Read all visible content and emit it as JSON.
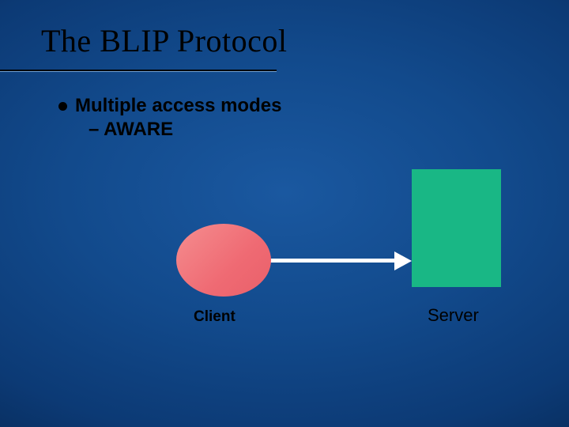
{
  "title": "The BLIP Protocol",
  "bullets": {
    "main": "Multiple access modes",
    "sub": "– AWARE"
  },
  "diagram": {
    "client_label": "Client",
    "server_label": "Server"
  }
}
